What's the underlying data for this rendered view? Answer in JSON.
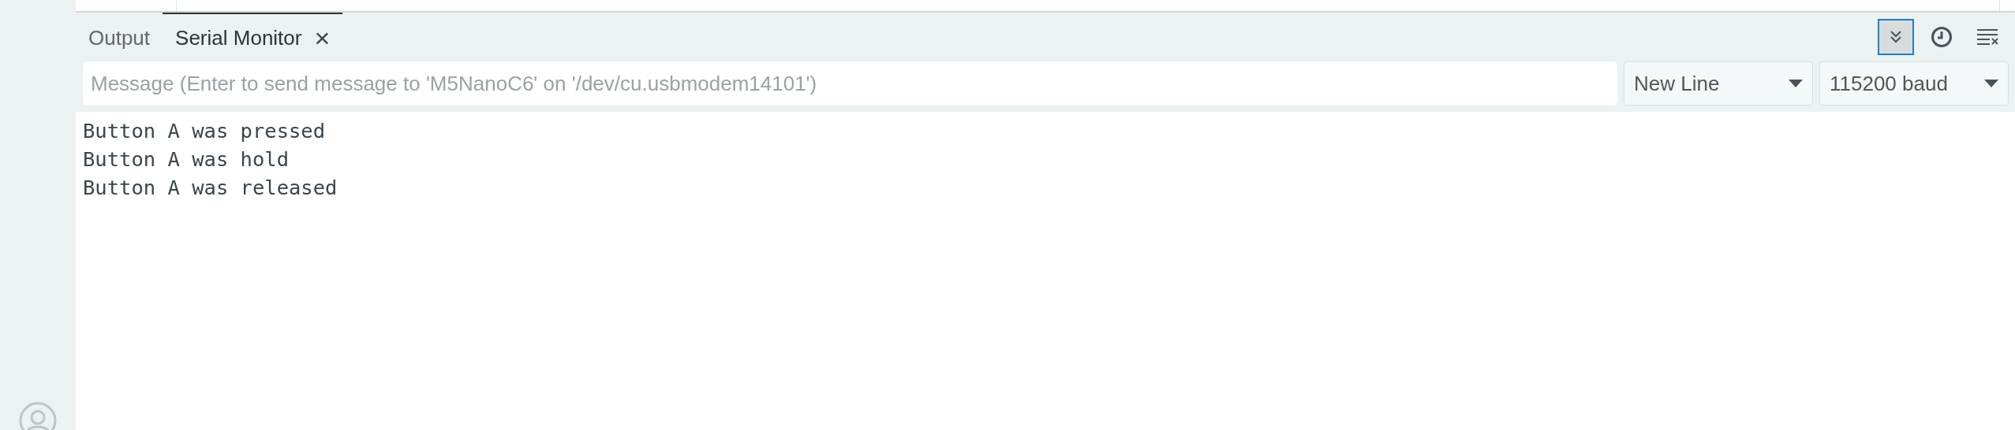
{
  "tabs": [
    {
      "label": "Output",
      "selected": false
    },
    {
      "label": "Serial Monitor",
      "selected": true,
      "close": "×"
    }
  ],
  "toolbar": [
    {
      "kind": "autoscroll",
      "selected": true
    },
    {
      "kind": "timestamp",
      "selected": false
    },
    {
      "kind": "clear",
      "selected": false
    }
  ],
  "message_field": {
    "placeholder": "Message (Enter to send message to 'M5NanoC6' on '/dev/cu.usbmodem14101')"
  },
  "line_ending": {
    "value": "New Line"
  },
  "baud_rate": {
    "value": "115200 baud"
  },
  "output_lines": [
    "Button A was pressed",
    "Button A was hold",
    "Button A was released"
  ]
}
